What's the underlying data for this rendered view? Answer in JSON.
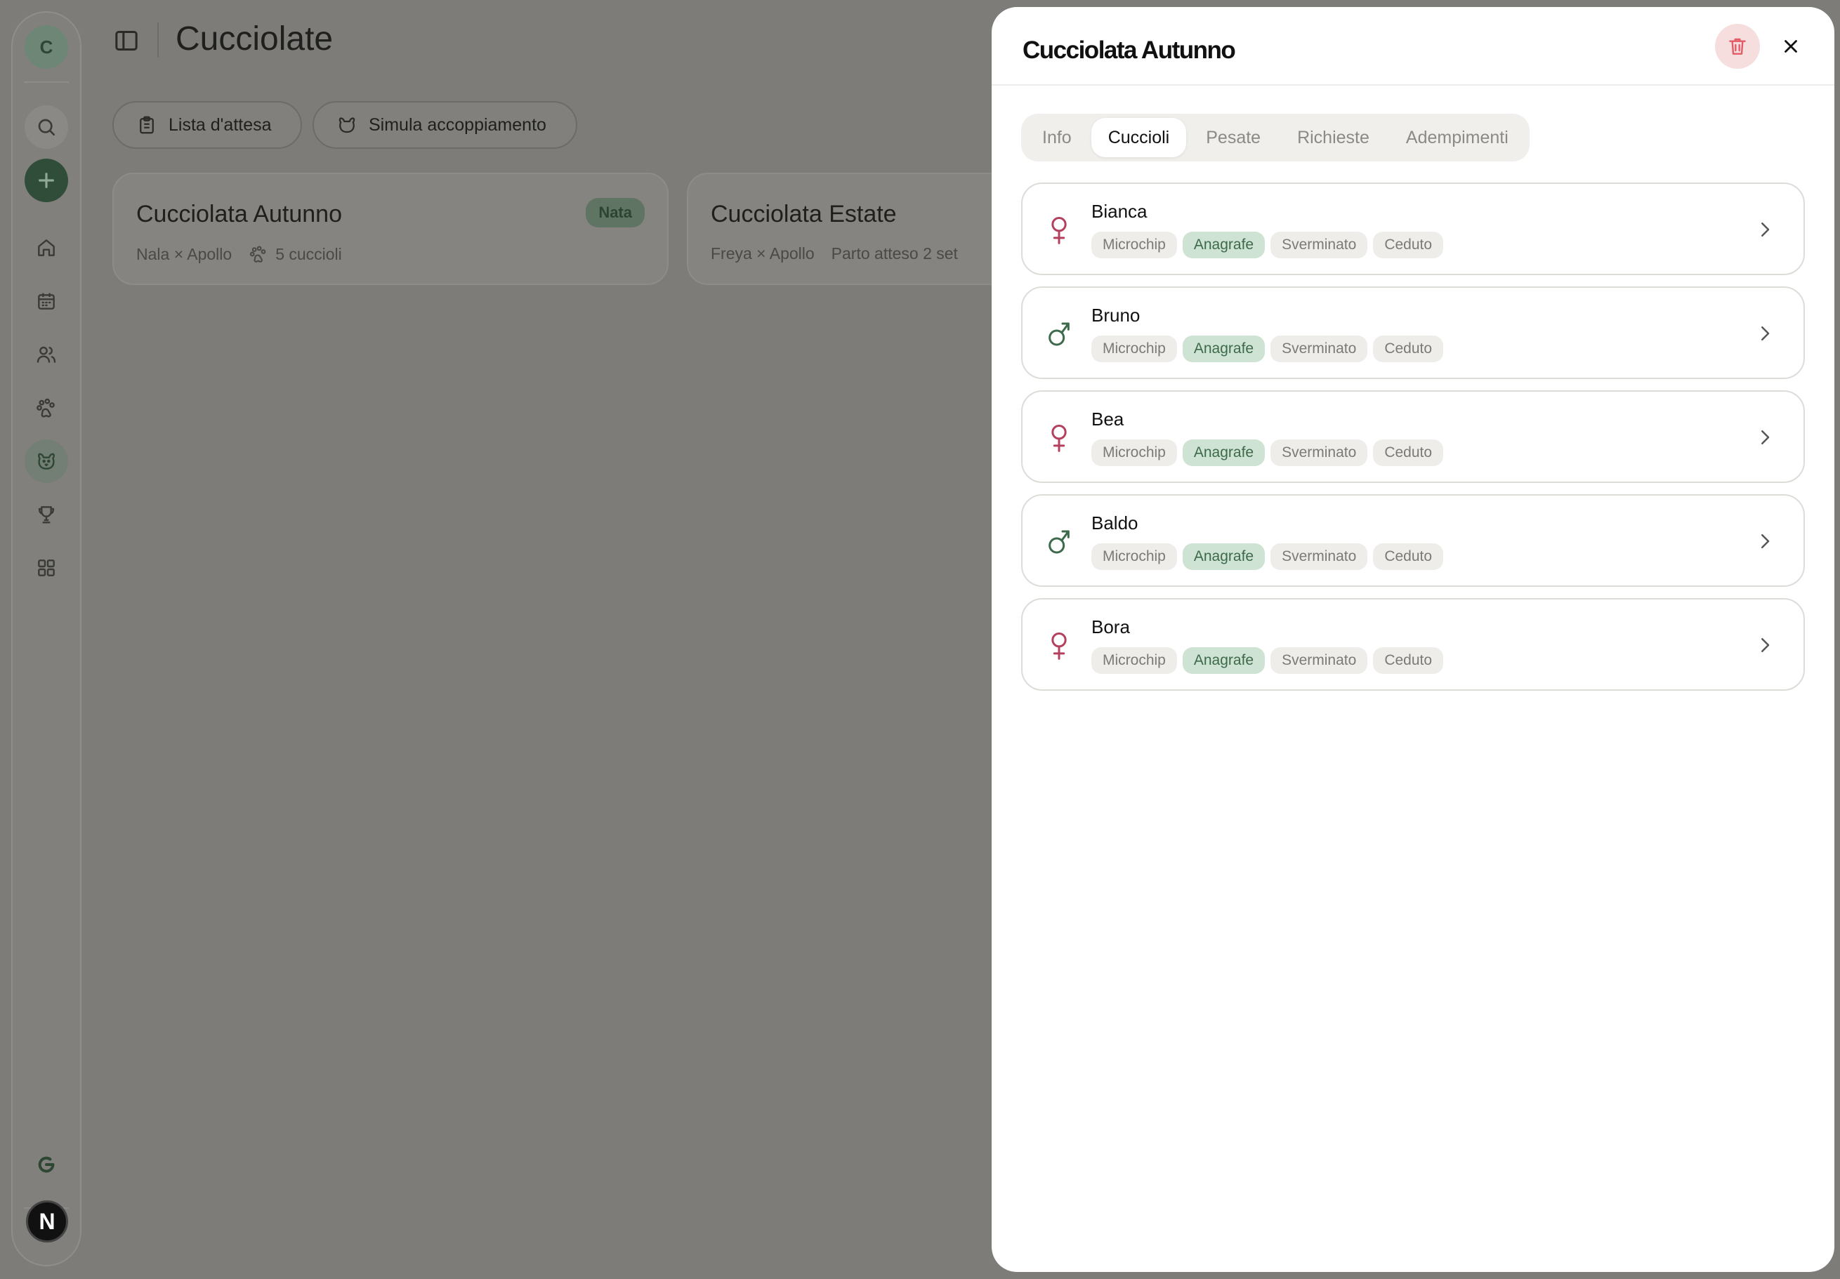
{
  "app": {
    "user_initial": "C",
    "logo_letter": "N",
    "page_title": "Cucciolate",
    "colors": {
      "brand_green": "#2f4d38",
      "female": "#b5405c",
      "male": "#3c6a4a",
      "danger": "#e35b67"
    }
  },
  "sidebar": {
    "icons": [
      "search-icon",
      "plus-icon",
      "home-icon",
      "calendar-icon",
      "users-icon",
      "paw-icon",
      "dog-icon",
      "trophy-icon",
      "grid-icon",
      "refresh-icon"
    ]
  },
  "toolbar": {
    "waitlist_label": "Lista d'attesa",
    "simulate_label": "Simula accoppiamento"
  },
  "litters": [
    {
      "title": "Cucciolata Autunno",
      "parents": "Nala × Apollo",
      "pups": "5 cuccioli",
      "status": "Nata"
    },
    {
      "title": "Cucciolata Estate",
      "parents": "Freya × Apollo",
      "expected": "Parto atteso 2 set"
    }
  ],
  "drawer": {
    "title": "Cucciolata Autunno",
    "tabs": [
      {
        "label": "Info",
        "active": false
      },
      {
        "label": "Cuccioli",
        "active": true
      },
      {
        "label": "Pesate",
        "active": false
      },
      {
        "label": "Richieste",
        "active": false
      },
      {
        "label": "Adempimenti",
        "active": false
      }
    ],
    "puppies": [
      {
        "name": "Bianca",
        "sex": "female",
        "tags": [
          "Microchip",
          "Anagrafe",
          "Sverminato",
          "Ceduto"
        ],
        "done": [
          false,
          true,
          false,
          false
        ]
      },
      {
        "name": "Bruno",
        "sex": "male",
        "tags": [
          "Microchip",
          "Anagrafe",
          "Sverminato",
          "Ceduto"
        ],
        "done": [
          false,
          true,
          false,
          false
        ]
      },
      {
        "name": "Bea",
        "sex": "female",
        "tags": [
          "Microchip",
          "Anagrafe",
          "Sverminato",
          "Ceduto"
        ],
        "done": [
          false,
          true,
          false,
          false
        ]
      },
      {
        "name": "Baldo",
        "sex": "male",
        "tags": [
          "Microchip",
          "Anagrafe",
          "Sverminato",
          "Ceduto"
        ],
        "done": [
          false,
          true,
          false,
          false
        ]
      },
      {
        "name": "Bora",
        "sex": "female",
        "tags": [
          "Microchip",
          "Anagrafe",
          "Sverminato",
          "Ceduto"
        ],
        "done": [
          false,
          true,
          false,
          false
        ]
      }
    ]
  }
}
